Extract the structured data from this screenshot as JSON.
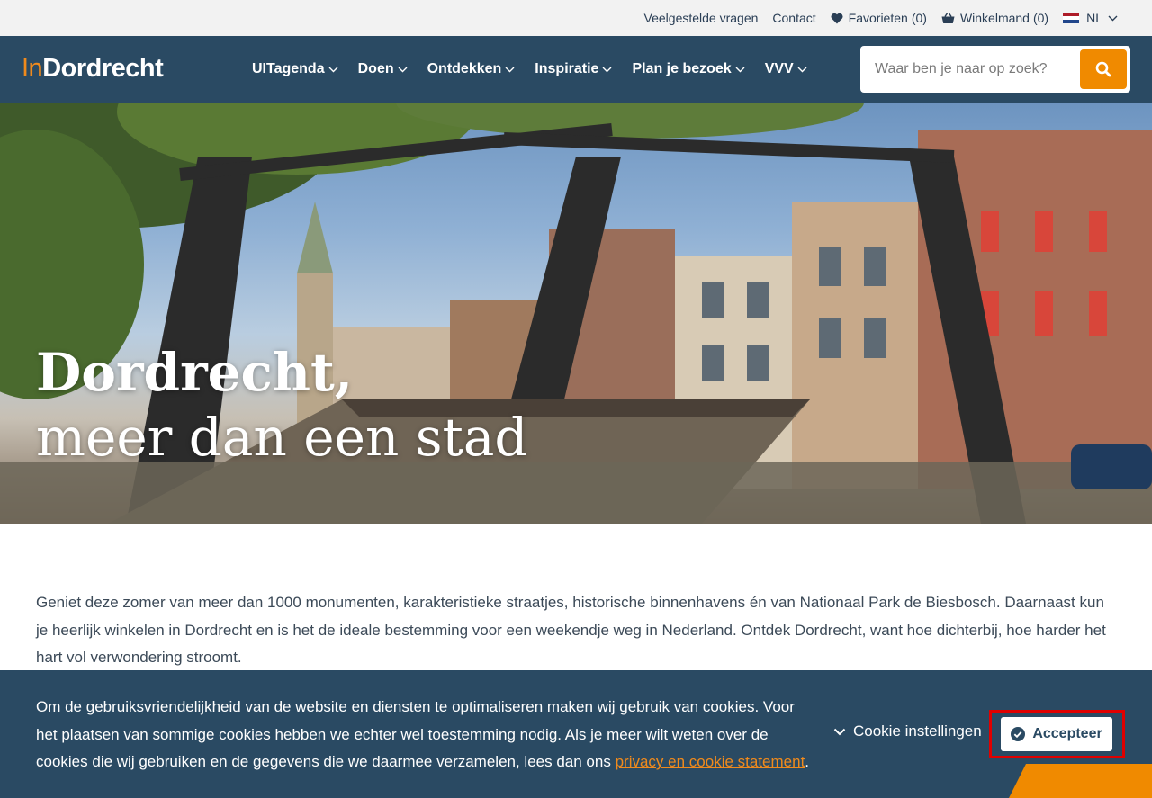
{
  "topbar": {
    "faq": "Veelgestelde vragen",
    "contact": "Contact",
    "favorites_label": "Favorieten",
    "favorites_count": "(0)",
    "cart_label": "Winkelmand",
    "cart_count": "(0)",
    "language": "NL"
  },
  "logo": {
    "prefix": "In",
    "name": "Dordrecht"
  },
  "nav": {
    "items": [
      {
        "label": "UITagenda"
      },
      {
        "label": "Doen"
      },
      {
        "label": "Ontdekken"
      },
      {
        "label": "Inspiratie"
      },
      {
        "label": "Plan je bezoek"
      },
      {
        "label": "VVV"
      }
    ]
  },
  "search": {
    "placeholder": "Waar ben je naar op zoek?"
  },
  "hero": {
    "title_line1": "Dordrecht,",
    "title_line2": "meer dan een stad"
  },
  "intro": {
    "text": "Geniet deze zomer van meer dan 1000 monumenten, karakteristieke straatjes, historische binnenhavens én van Nationaal Park de Biesbosch. Daarnaast kun je heerlijk winkelen in Dordrecht en is het de ideale bestemming voor een weekendje weg in Nederland. Ontdek Dordrecht, want hoe dichterbij, hoe harder het hart vol verwondering stroomt."
  },
  "cookie": {
    "text": "Om de gebruiksvriendelijkheid van de website en diensten te optimaliseren maken wij gebruik van cookies. Voor het plaatsen van sommige cookies hebben we echter wel toestemming nodig. Als je meer wilt weten over de cookies die wij gebruiken en de gegevens die we daarmee verzamelen, lees dan ons",
    "link": "privacy en cookie statement",
    "period": ".",
    "settings": "Cookie instellingen",
    "accept": "Accepteer"
  },
  "colors": {
    "navy": "#2a4a63",
    "orange": "#f08a00",
    "topbar": "#f2f2f2",
    "highlight": "#e00000"
  },
  "icons": [
    "heart-icon",
    "basket-icon",
    "nl-flag-icon",
    "chevron-down-icon",
    "search-icon",
    "check-circle-icon"
  ]
}
